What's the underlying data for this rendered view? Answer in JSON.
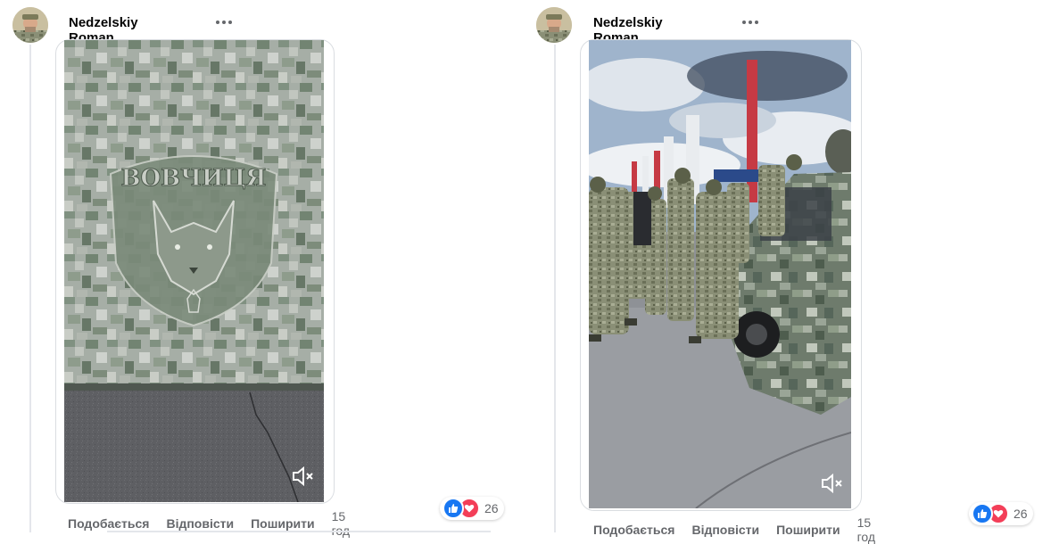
{
  "posts": [
    {
      "author": "Nedzelskiy Roman",
      "emblem_text": "ВОВЧИЦЯ",
      "actions": {
        "like": "Подобається",
        "reply": "Відповісти",
        "share": "Поширити",
        "time": "15 год"
      },
      "reactions": {
        "count": "26",
        "types": [
          "like-icon",
          "love-icon"
        ]
      }
    },
    {
      "author": "Nedzelskiy Roman",
      "actions": {
        "like": "Подобається",
        "reply": "Відповісти",
        "share": "Поширити",
        "time": "15 год"
      },
      "reactions": {
        "count": "26",
        "types": [
          "like-icon",
          "love-icon"
        ]
      }
    }
  ],
  "colors": {
    "like": "#1877f2",
    "love": "#f33e58",
    "text_secondary": "#65676b"
  }
}
